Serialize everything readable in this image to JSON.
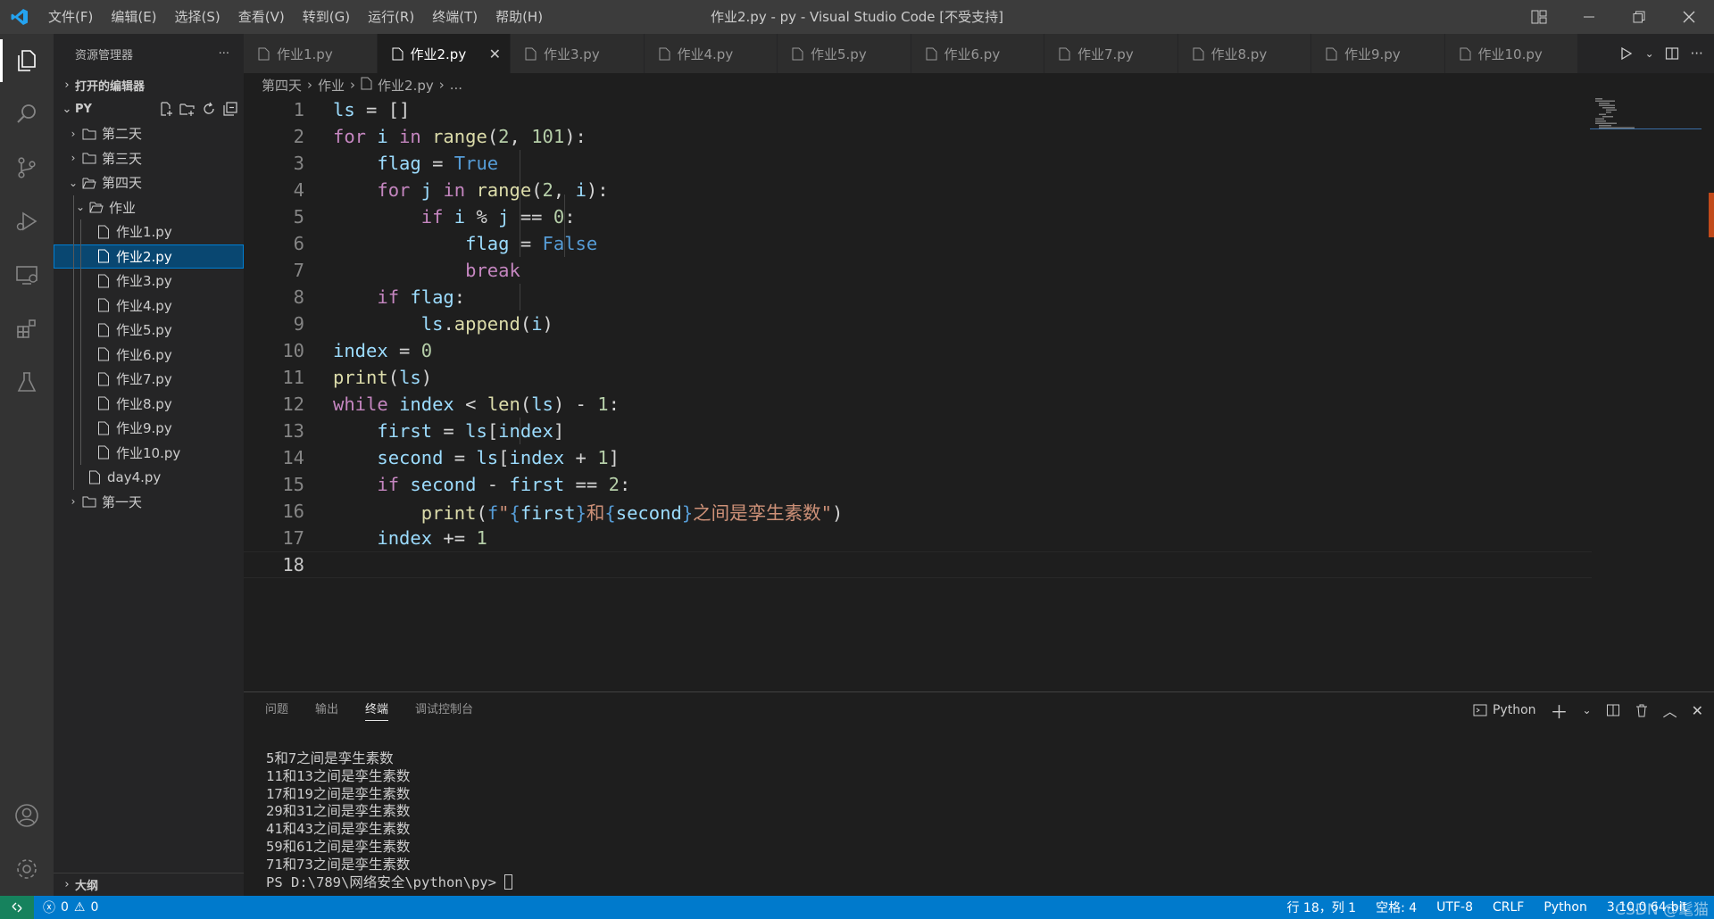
{
  "window": {
    "title": "作业2.py - py - Visual Studio Code [不受支持]",
    "menu": [
      "文件(F)",
      "编辑(E)",
      "选择(S)",
      "查看(V)",
      "转到(G)",
      "运行(R)",
      "终端(T)",
      "帮助(H)"
    ]
  },
  "sidebar": {
    "title": "资源管理器",
    "open_editors": "打开的编辑器",
    "root": "PY",
    "tree": {
      "folder_day2": "第二天",
      "folder_day3": "第三天",
      "folder_day4": "第四天",
      "folder_homework": "作业",
      "files": [
        "作业1.py",
        "作业2.py",
        "作业3.py",
        "作业4.py",
        "作业5.py",
        "作业6.py",
        "作业7.py",
        "作业8.py",
        "作业9.py",
        "作业10.py"
      ],
      "day4_file": "day4.py",
      "folder_day1": "第一天"
    },
    "outline": "大纲"
  },
  "tabs": [
    "作业1.py",
    "作业2.py",
    "作业3.py",
    "作业4.py",
    "作业5.py",
    "作业6.py",
    "作业7.py",
    "作业8.py",
    "作业9.py",
    "作业10.py"
  ],
  "active_tab": "作业2.py",
  "breadcrumb": {
    "a": "第四天",
    "b": "作业",
    "c": "作业2.py",
    "d": "..."
  },
  "editor": {
    "line_numbers": [
      "1",
      "2",
      "3",
      "4",
      "5",
      "6",
      "7",
      "8",
      "9",
      "10",
      "11",
      "12",
      "13",
      "14",
      "15",
      "16",
      "17",
      "18"
    ],
    "current_line": 18
  },
  "panel": {
    "tabs": [
      "问题",
      "输出",
      "终端",
      "调试控制台"
    ],
    "active_tab": "终端",
    "shell": "Python",
    "terminal_lines": [
      "5和7之间是孪生素数",
      "11和13之间是孪生素数",
      "17和19之间是孪生素数",
      "29和31之间是孪生素数",
      "41和43之间是孪生素数",
      "59和61之间是孪生素数",
      "71和73之间是孪生素数"
    ],
    "prompt": "PS D:\\789\\网络安全\\python\\py> "
  },
  "statusbar": {
    "errors": "0",
    "warnings": "0",
    "position": "行 18，列 1",
    "spaces": "空格: 4",
    "encoding": "UTF-8",
    "eol": "CRLF",
    "language": "Python",
    "interpreter": "3.10.0 64-bit",
    "watermark": "CSDN @髦猫"
  },
  "colors": {
    "accent": "#007acc",
    "remote": "#16825d",
    "selection": "#094771"
  }
}
